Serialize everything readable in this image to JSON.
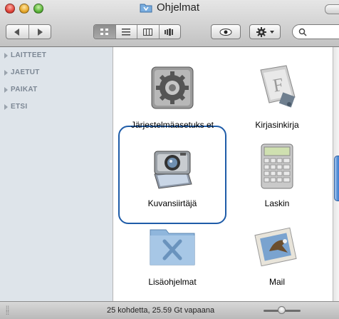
{
  "window": {
    "title": "Ohjelmat"
  },
  "toolbar": {
    "back": "◀",
    "forward": "▶",
    "views": [
      "icon-view",
      "list-view",
      "column-view",
      "coverflow-view"
    ],
    "quicklook": "eye-icon",
    "action": "gear-icon",
    "search_placeholder": ""
  },
  "sidebar": {
    "items": [
      {
        "label": "LAITTEET"
      },
      {
        "label": "JAETUT"
      },
      {
        "label": "PAIKAT"
      },
      {
        "label": "ETSI"
      }
    ]
  },
  "content": {
    "items": [
      {
        "label": "Järjestelmäasetuks et",
        "icon": "system-preferences-icon"
      },
      {
        "label": "Kirjasinkirja",
        "icon": "font-book-icon"
      },
      {
        "label": "Kuvansiirtäjä",
        "icon": "image-capture-icon",
        "selected": true
      },
      {
        "label": "Laskin",
        "icon": "calculator-icon"
      },
      {
        "label": "Lisäohjelmat",
        "icon": "utilities-folder-icon"
      },
      {
        "label": "Mail",
        "icon": "mail-icon"
      }
    ]
  },
  "status": {
    "text": "25 kohdetta, 25.59 Gt vapaana"
  },
  "colors": {
    "selection": "#1f5ca8",
    "sidebar_bg": "#dee4ea"
  }
}
